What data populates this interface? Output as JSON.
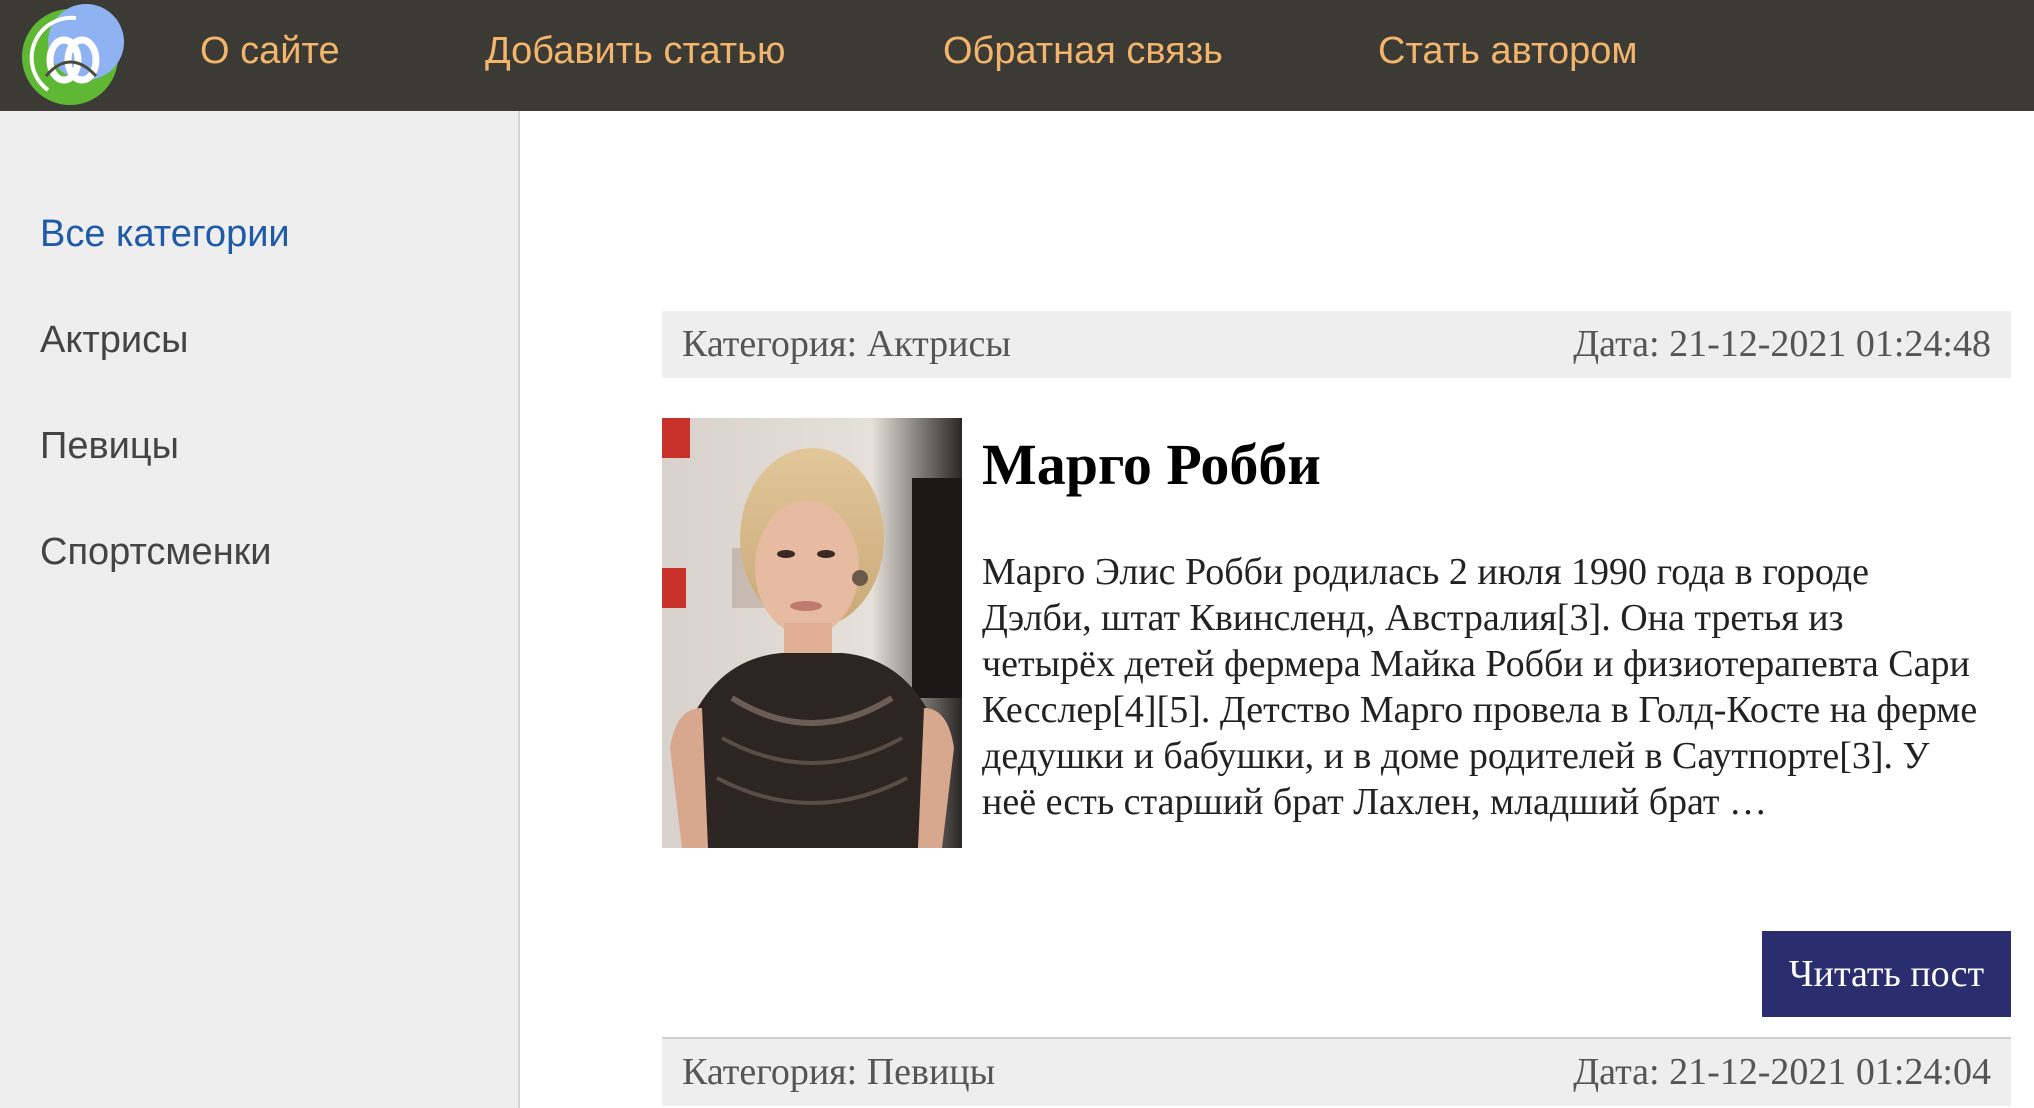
{
  "header": {
    "logo_icon": "site-logo-icon",
    "nav": [
      {
        "label": "О сайте"
      },
      {
        "label": "Добавить статью"
      },
      {
        "label": "Обратная связь"
      },
      {
        "label": "Стать автором"
      }
    ]
  },
  "sidebar": {
    "items": [
      {
        "label": "Все категории",
        "active": true
      },
      {
        "label": "Актрисы",
        "active": false
      },
      {
        "label": "Певицы",
        "active": false
      },
      {
        "label": "Спортсменки",
        "active": false
      }
    ]
  },
  "posts": [
    {
      "category": "Категория: Актрисы",
      "date": "Дата: 21-12-2021 01:24:48",
      "title": "Марго Робби",
      "excerpt": "Марго Элис Робби родилась 2 июля 1990 года в городе Дэлби, штат Квинсленд, Австралия[3]. Она третья из четырёх детей фермера Майка Робби и физиотерапевта Сари Кесслер[4][5]. Детство Марго провела в Голд-Косте на ферме дедушки и бабушки, и в доме родителей в Саутпорте[3]. У неё есть старший брат Лахлен, младший брат …",
      "button_label": "Читать пост"
    },
    {
      "category": "Категория: Певицы",
      "date": "Дата: 21-12-2021 01:24:04"
    }
  ],
  "colors": {
    "topbar_bg": "#3b3a34",
    "nav_text": "#f2b56b",
    "sidebar_bg": "#eeeeee",
    "active_link": "#1f5aa8",
    "button_bg": "#2b2e6e"
  }
}
